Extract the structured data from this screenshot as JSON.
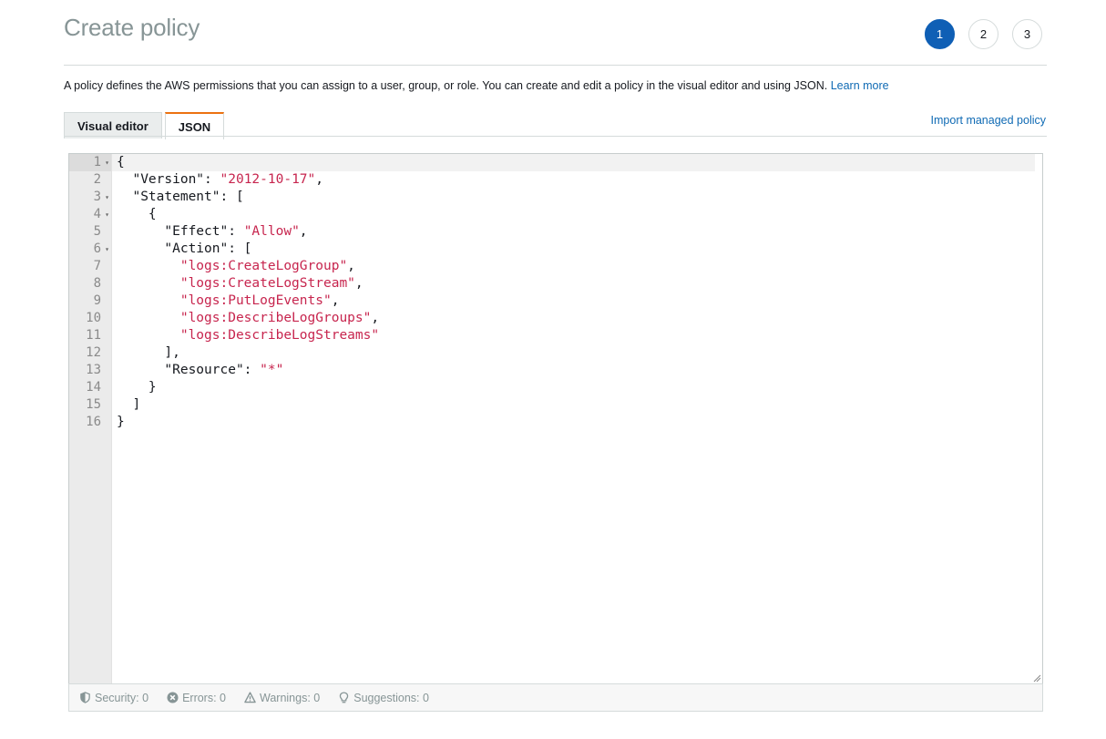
{
  "page": {
    "title": "Create policy",
    "description": "A policy defines the AWS permissions that you can assign to a user, group, or role. You can create and edit a policy in the visual editor and using JSON.",
    "learn_more": "Learn more"
  },
  "steps": [
    {
      "label": "1",
      "active": true
    },
    {
      "label": "2",
      "active": false
    },
    {
      "label": "3",
      "active": false
    }
  ],
  "tabs": {
    "visual_editor": "Visual editor",
    "json": "JSON",
    "active": "JSON"
  },
  "import_link": "Import managed policy",
  "editor": {
    "line_numbers": [
      "1",
      "2",
      "3",
      "4",
      "5",
      "6",
      "7",
      "8",
      "9",
      "10",
      "11",
      "12",
      "13",
      "14",
      "15",
      "16"
    ],
    "foldable_lines": [
      "1",
      "3",
      "4",
      "6"
    ],
    "current_line": "1",
    "lines": [
      [
        {
          "t": "{"
        }
      ],
      [
        {
          "t": "  \"Version\": "
        },
        {
          "t": "\"2012-10-17\"",
          "s": true
        },
        {
          "t": ","
        }
      ],
      [
        {
          "t": "  \"Statement\": ["
        }
      ],
      [
        {
          "t": "    {"
        }
      ],
      [
        {
          "t": "      \"Effect\": "
        },
        {
          "t": "\"Allow\"",
          "s": true
        },
        {
          "t": ","
        }
      ],
      [
        {
          "t": "      \"Action\": ["
        }
      ],
      [
        {
          "t": "        "
        },
        {
          "t": "\"logs:CreateLogGroup\"",
          "s": true
        },
        {
          "t": ","
        }
      ],
      [
        {
          "t": "        "
        },
        {
          "t": "\"logs:CreateLogStream\"",
          "s": true
        },
        {
          "t": ","
        }
      ],
      [
        {
          "t": "        "
        },
        {
          "t": "\"logs:PutLogEvents\"",
          "s": true
        },
        {
          "t": ","
        }
      ],
      [
        {
          "t": "        "
        },
        {
          "t": "\"logs:DescribeLogGroups\"",
          "s": true
        },
        {
          "t": ","
        }
      ],
      [
        {
          "t": "        "
        },
        {
          "t": "\"logs:DescribeLogStreams\"",
          "s": true
        }
      ],
      [
        {
          "t": "      ],"
        }
      ],
      [
        {
          "t": "      \"Resource\": "
        },
        {
          "t": "\"*\"",
          "s": true
        }
      ],
      [
        {
          "t": "    }"
        }
      ],
      [
        {
          "t": "  ]"
        }
      ],
      [
        {
          "t": "}"
        }
      ]
    ]
  },
  "status": {
    "security": "Security: 0",
    "errors": "Errors: 0",
    "warnings": "Warnings: 0",
    "suggestions": "Suggestions: 0"
  },
  "colors": {
    "accent_blue": "#0f5fb5",
    "link": "#0f6ab4",
    "tab_active_border": "#ec7211",
    "json_string": "#c7254e"
  }
}
